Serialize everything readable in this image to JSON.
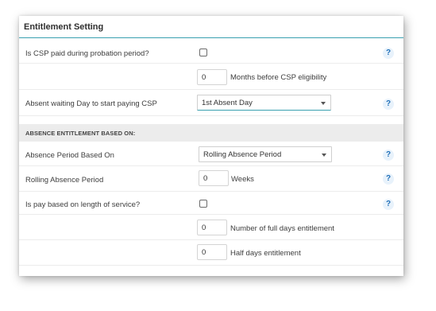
{
  "panel": {
    "title": "Entitlement Setting"
  },
  "rows": {
    "csp_probation": {
      "label": "Is CSP paid during probation period?",
      "checked": false,
      "help": "?"
    },
    "csp_months": {
      "value": "0",
      "suffix": "Months before CSP eligibility"
    },
    "absent_waiting": {
      "label": "Absent waiting Day to start paying CSP",
      "selected": "1st Absent Day",
      "help": "?"
    },
    "section_header": "ABSENCE ENTITLEMENT BASED ON:",
    "absence_period_based": {
      "label": "Absence Period Based On",
      "selected": "Rolling Absence Period",
      "help": "?"
    },
    "rolling_absence": {
      "label": "Rolling Absence Period",
      "value": "0",
      "suffix": "Weeks",
      "help": "?"
    },
    "pay_length_service": {
      "label": "Is pay based on length of service?",
      "checked": false,
      "help": "?"
    },
    "full_days": {
      "value": "0",
      "suffix": "Number of full days entitlement"
    },
    "half_days": {
      "value": "0",
      "suffix": "Half days entitlement"
    }
  }
}
